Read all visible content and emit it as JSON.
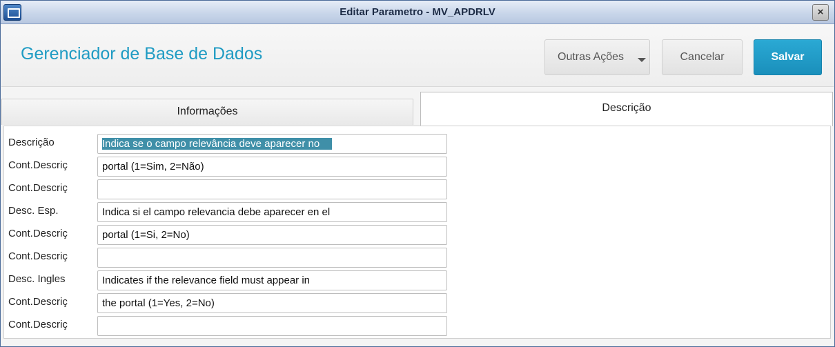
{
  "window": {
    "title": "Editar Parametro - MV_APDRLV",
    "close_symbol": "×"
  },
  "header": {
    "title": "Gerenciador de Base de Dados",
    "buttons": {
      "outras": "Outras Ações",
      "cancelar": "Cancelar",
      "salvar": "Salvar"
    }
  },
  "tabs": [
    {
      "label": "Informações",
      "active": false
    },
    {
      "label": "Descrição",
      "active": true
    }
  ],
  "fields": [
    {
      "label": "Descrição",
      "value": "Indica se o campo relevância deve aparecer no"
    },
    {
      "label": "Cont.Descriç",
      "value": "portal (1=Sim, 2=Não)"
    },
    {
      "label": "Cont.Descriç",
      "value": ""
    },
    {
      "label": "Desc. Esp.",
      "value": "Indica si el campo relevancia debe aparecer en el"
    },
    {
      "label": "Cont.Descriç",
      "value": "portal (1=Si, 2=No)"
    },
    {
      "label": "Cont.Descriç",
      "value": ""
    },
    {
      "label": "Desc. Ingles",
      "value": "Indicates if the relevance field must appear in"
    },
    {
      "label": "Cont.Descriç",
      "value": "the portal (1=Yes, 2=No)"
    },
    {
      "label": "Cont.Descriç",
      "value": ""
    }
  ],
  "colors": {
    "accent": "#1f9bc3",
    "primary_button": "#1a8fbb",
    "selection": "#3f8fa8"
  }
}
